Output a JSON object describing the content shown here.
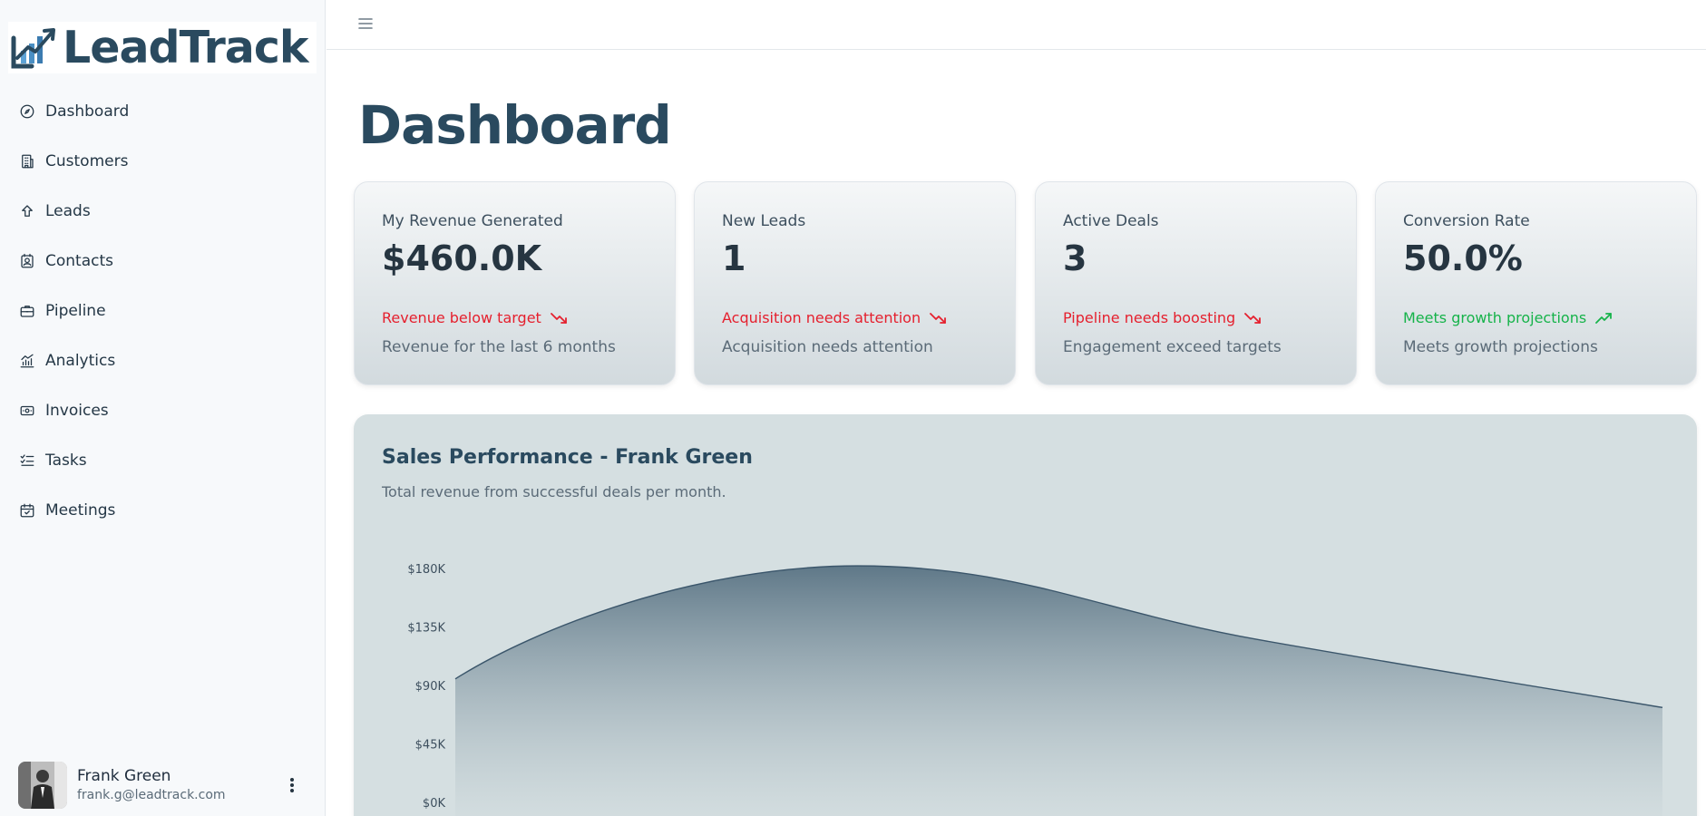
{
  "app": {
    "logo_text": "LeadTrack"
  },
  "sidebar": {
    "items": [
      {
        "label": "Dashboard",
        "icon": "compass-icon"
      },
      {
        "label": "Customers",
        "icon": "building-icon"
      },
      {
        "label": "Leads",
        "icon": "arrow-up-icon"
      },
      {
        "label": "Contacts",
        "icon": "contact-card-icon"
      },
      {
        "label": "Pipeline",
        "icon": "briefcase-icon"
      },
      {
        "label": "Analytics",
        "icon": "bar-chart-icon"
      },
      {
        "label": "Invoices",
        "icon": "banknote-icon"
      },
      {
        "label": "Tasks",
        "icon": "checklist-icon"
      },
      {
        "label": "Meetings",
        "icon": "calendar-icon"
      }
    ],
    "user": {
      "name": "Frank Green",
      "email": "frank.g@leadtrack.com"
    }
  },
  "header": {
    "title": "Dashboard"
  },
  "cards": [
    {
      "label": "My Revenue Generated",
      "value": "$460.0K",
      "trend": "Revenue below target",
      "trend_dir": "down",
      "note": "Revenue for the last 6 months"
    },
    {
      "label": "New Leads",
      "value": "1",
      "trend": "Acquisition needs attention",
      "trend_dir": "down",
      "note": "Acquisition needs attention"
    },
    {
      "label": "Active Deals",
      "value": "3",
      "trend": "Pipeline needs boosting",
      "trend_dir": "down",
      "note": "Engagement exceed targets"
    },
    {
      "label": "Conversion Rate",
      "value": "50.0%",
      "trend": "Meets growth projections",
      "trend_dir": "up",
      "note": "Meets growth projections"
    }
  ],
  "colors": {
    "brand": "#2a4a5f",
    "negative": "#e5202e",
    "positive": "#16b34a",
    "chart_line": "#3b566b"
  },
  "chart": {
    "title": "Sales Performance - Frank Green",
    "subtitle": "Total revenue from successful deals per month."
  },
  "chart_data": {
    "type": "area",
    "title": "Sales Performance - Frank Green",
    "subtitle": "Total revenue from successful deals per month.",
    "xlabel": "",
    "ylabel": "",
    "y_ticks": [
      "$0K",
      "$45K",
      "$90K",
      "$135K",
      "$180K"
    ],
    "ylim": [
      0,
      180000
    ],
    "values": [
      95000,
      182000,
      125000,
      73000
    ],
    "grid": false
  }
}
